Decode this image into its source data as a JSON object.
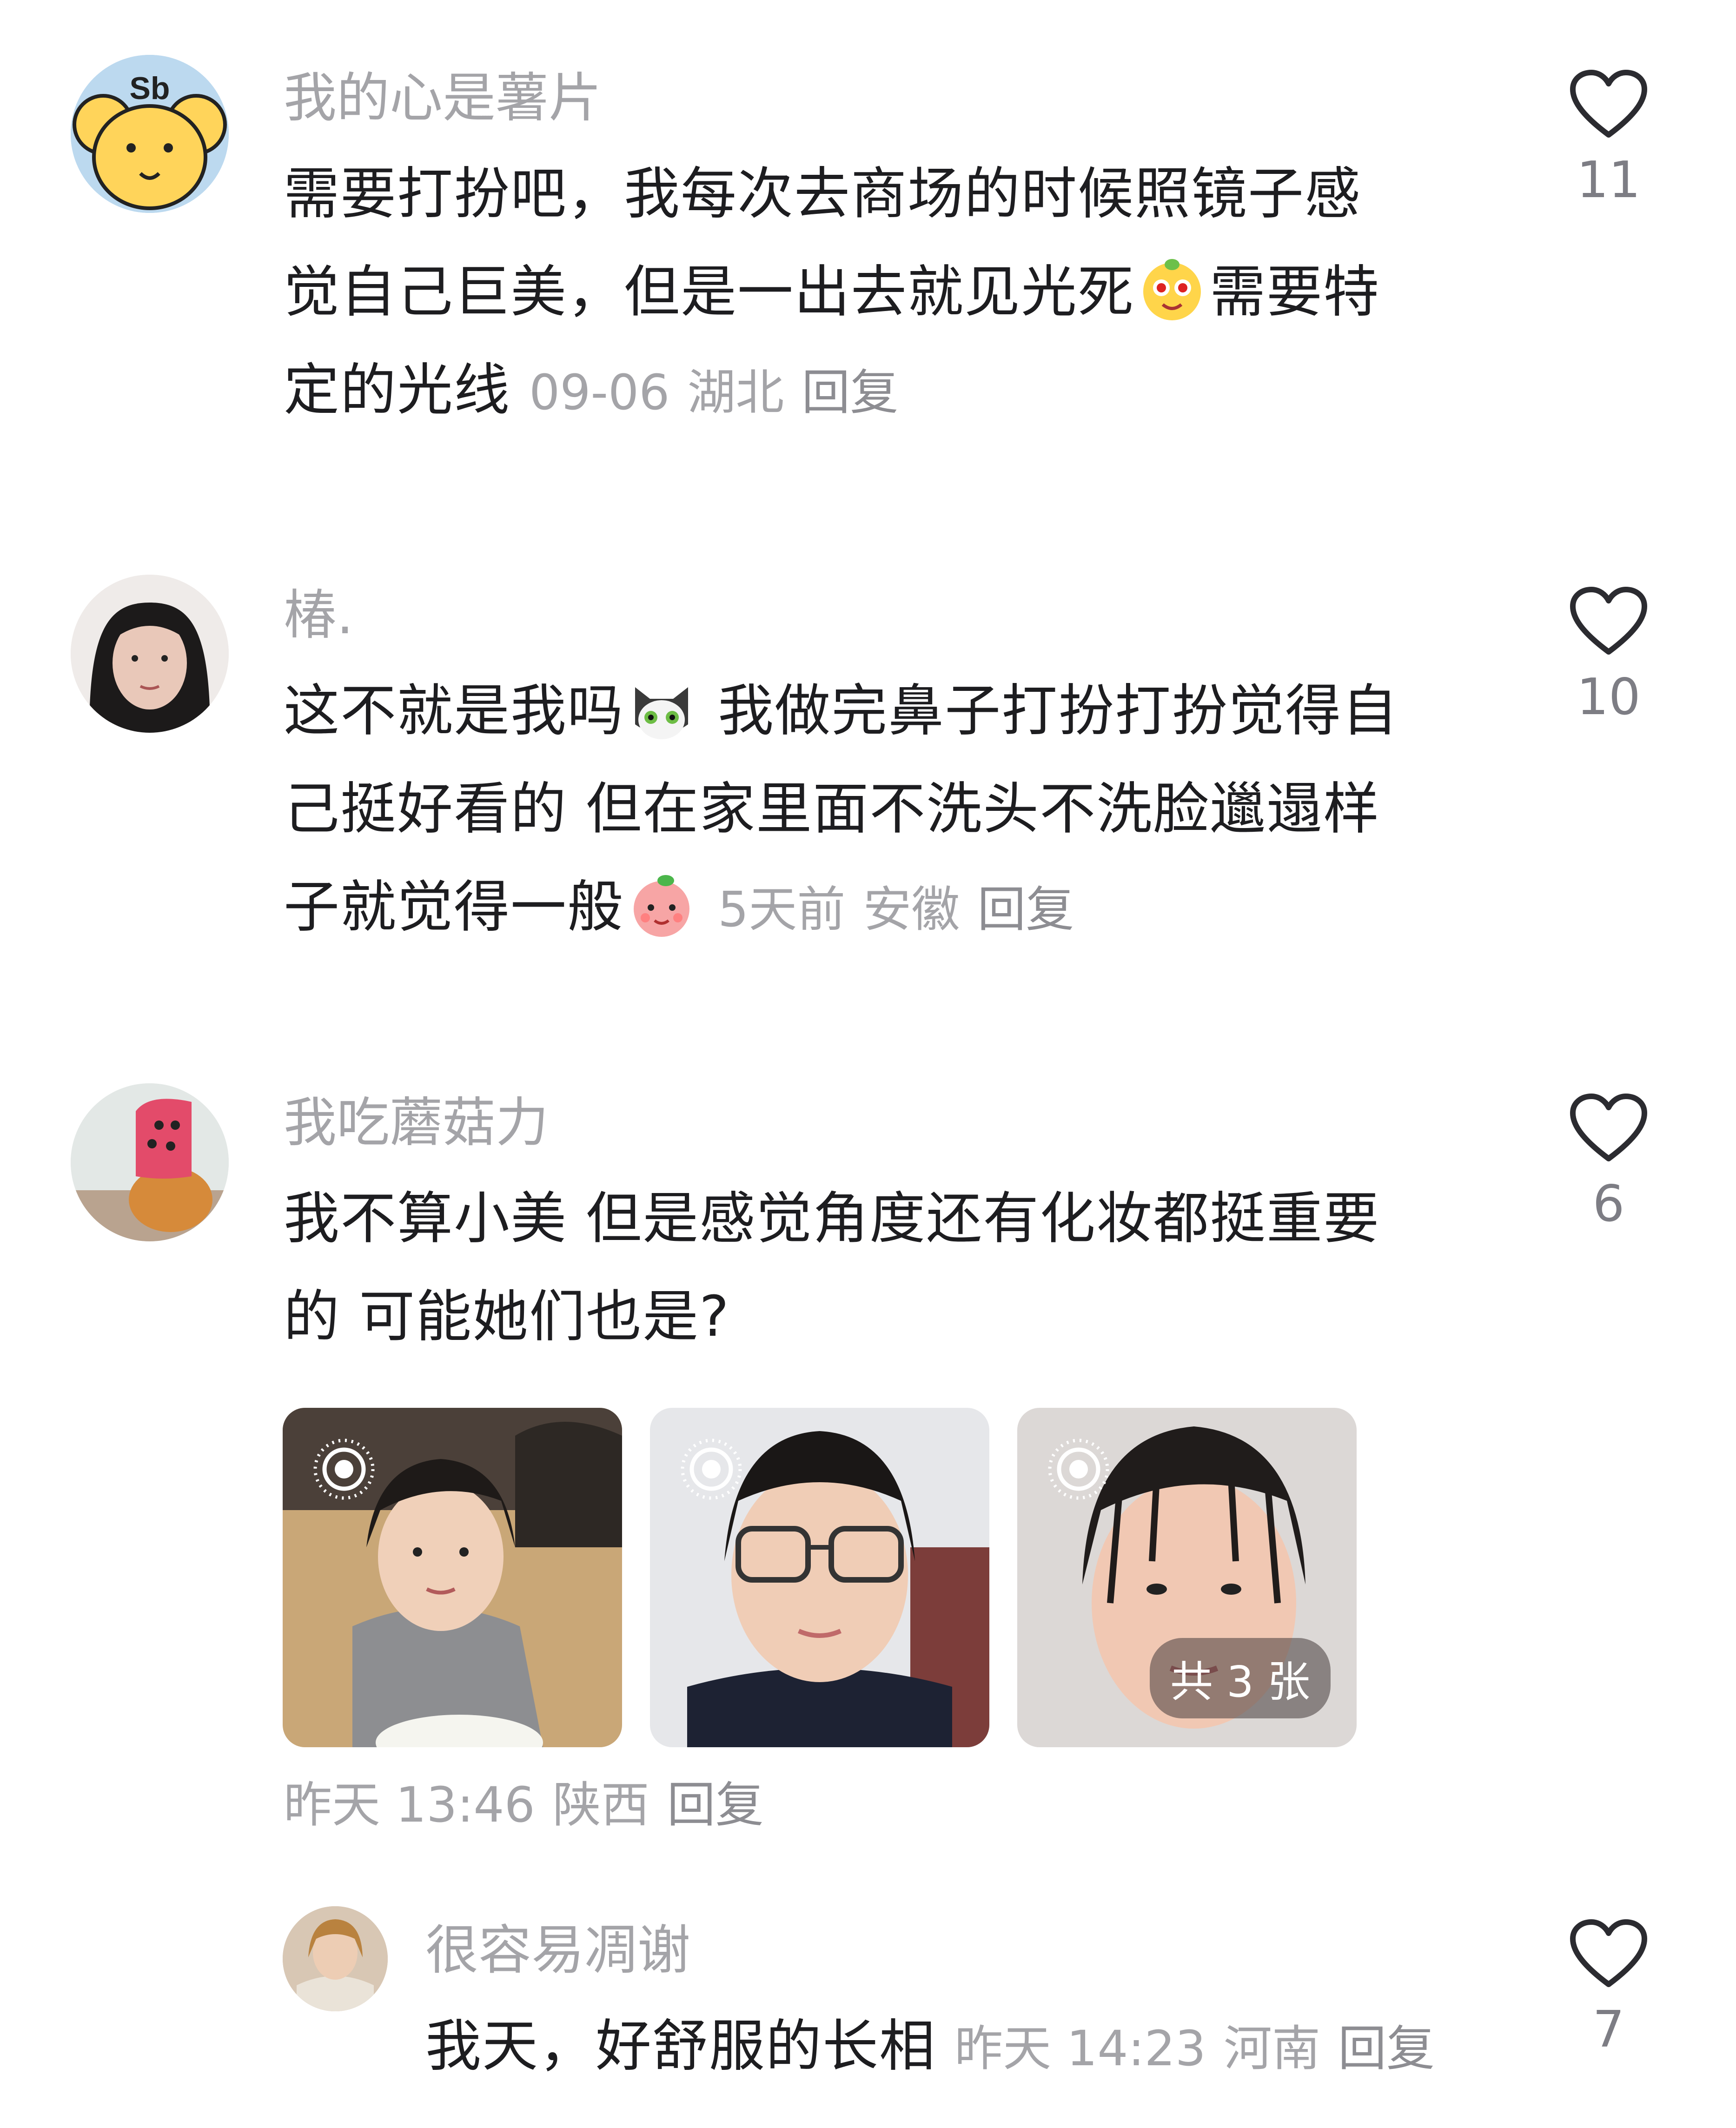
{
  "comments": [
    {
      "username": "我的心是薯片",
      "lines": [
        "需要打扮吧，我每次去商场的时候照镜子感",
        "觉自己巨美，但是一出去就见光死",
        "需要特",
        "定的光线"
      ],
      "date": "09-06",
      "location": "湖北",
      "reply": "回复",
      "likes": "11",
      "avatar_icon": "bear-sb-avatar"
    },
    {
      "username": "椿.",
      "lines": [
        "这不就是我吗",
        " 我做完鼻子打扮打扮觉得自",
        "己挺好看的 但在家里面不洗头不洗脸邋遢样",
        "子就觉得一般"
      ],
      "date": "5天前",
      "location": "安徽",
      "reply": "回复",
      "likes": "10",
      "avatar_icon": "girl-photo-avatar"
    },
    {
      "username": "我吃蘑菇力",
      "lines": [
        "我不算小美 但是感觉角度还有化妆都挺重要",
        "的 可能她们也是?"
      ],
      "date": "昨天 13:46",
      "location": "陕西",
      "reply": "回复",
      "likes": "6",
      "avatar_icon": "cat-hat-avatar",
      "images_badge": "共 3 张"
    },
    {
      "username": "很容易凋谢",
      "text": "我天，好舒服的长相",
      "date": "昨天 14:23",
      "location": "河南",
      "reply": "回复",
      "likes": "7",
      "avatar_icon": "woman-photo-avatar"
    }
  ],
  "colors": {
    "username": "#a4a4a8",
    "body": "#1d1d20",
    "meta": "#a4a4a8",
    "like_outline": "#2b2b30"
  },
  "icons": [
    "heart-outline-icon",
    "live-photo-icon",
    "smiley-emoji",
    "cat-emoji",
    "peach-emoji"
  ]
}
